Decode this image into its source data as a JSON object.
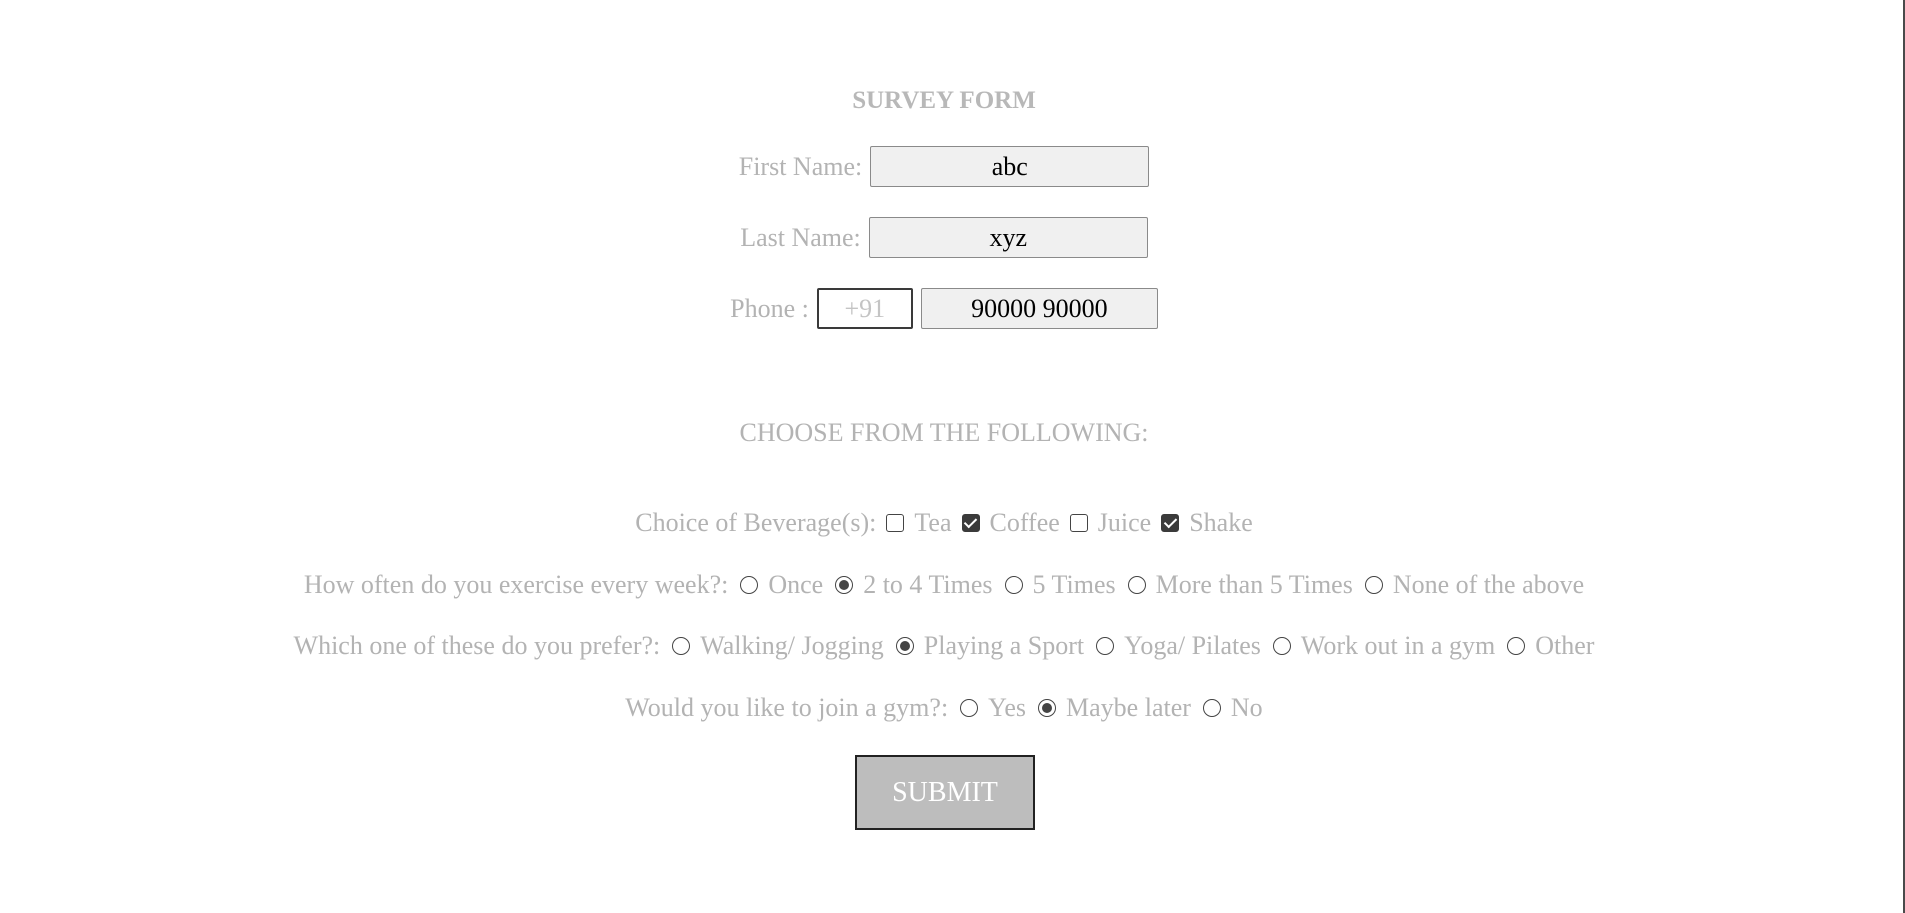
{
  "title": "SURVEY FORM",
  "first_name": {
    "label": "First Name:",
    "value": "abc"
  },
  "last_name": {
    "label": "Last Name:",
    "value": "xyz"
  },
  "phone": {
    "label": "Phone :",
    "code_placeholder": "+91",
    "number_value": "90000 90000"
  },
  "subtitle": "CHOOSE FROM THE FOLLOWING:",
  "beverage": {
    "label": "Choice of Beverage(s):",
    "options": [
      {
        "label": "Tea",
        "checked": false
      },
      {
        "label": "Coffee",
        "checked": true
      },
      {
        "label": "Juice",
        "checked": false
      },
      {
        "label": "Shake",
        "checked": true
      }
    ]
  },
  "exercise": {
    "label": "How often do you exercise every week?:",
    "options": [
      {
        "label": "Once",
        "selected": false
      },
      {
        "label": "2 to 4 Times",
        "selected": true
      },
      {
        "label": "5 Times",
        "selected": false
      },
      {
        "label": "More than 5 Times",
        "selected": false
      },
      {
        "label": "None of the above",
        "selected": false
      }
    ]
  },
  "prefer": {
    "label": "Which one of these do you prefer?:",
    "options": [
      {
        "label": "Walking/ Jogging",
        "selected": false
      },
      {
        "label": "Playing a Sport",
        "selected": true
      },
      {
        "label": "Yoga/ Pilates",
        "selected": false
      },
      {
        "label": "Work out in a gym",
        "selected": false
      },
      {
        "label": "Other",
        "selected": false
      }
    ]
  },
  "gym": {
    "label": "Would you like to join a gym?:",
    "options": [
      {
        "label": "Yes",
        "selected": false
      },
      {
        "label": "Maybe later",
        "selected": true
      },
      {
        "label": "No",
        "selected": false
      }
    ]
  },
  "submit_label": "SUBMIT"
}
